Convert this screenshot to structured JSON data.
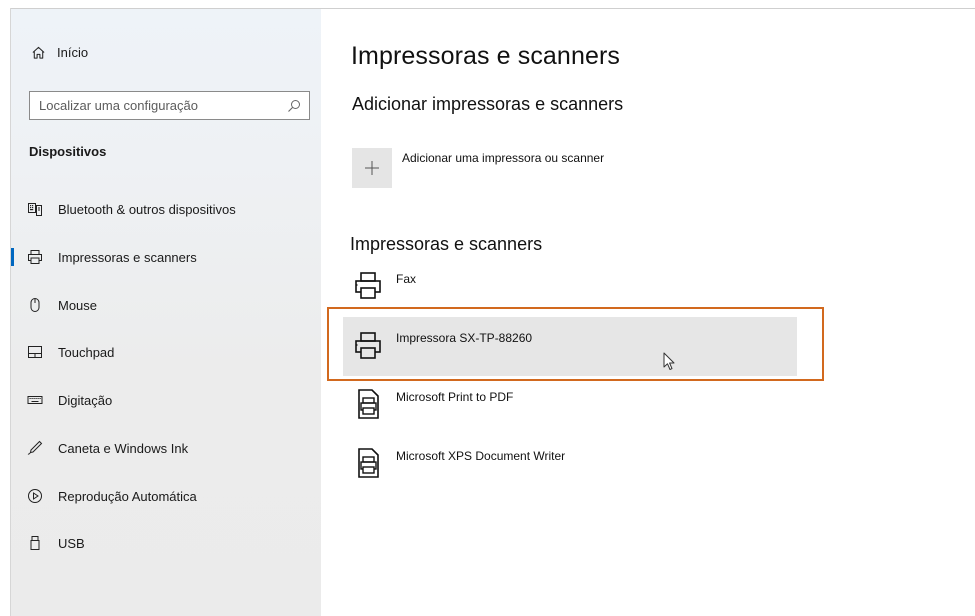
{
  "sidebar": {
    "home_label": "Início",
    "search_placeholder": "Localizar uma configuração",
    "section_title": "Dispositivos",
    "items": [
      {
        "label": "Bluetooth & outros dispositivos",
        "icon": "bluetooth-devices-icon"
      },
      {
        "label": "Impressoras e scanners",
        "icon": "printer-icon",
        "selected": true
      },
      {
        "label": "Mouse",
        "icon": "mouse-icon"
      },
      {
        "label": "Touchpad",
        "icon": "touchpad-icon"
      },
      {
        "label": "Digitação",
        "icon": "keyboard-icon"
      },
      {
        "label": "Caneta e Windows Ink",
        "icon": "pen-icon"
      },
      {
        "label": "Reprodução Automática",
        "icon": "autoplay-icon"
      },
      {
        "label": "USB",
        "icon": "usb-icon"
      }
    ]
  },
  "main": {
    "title": "Impressoras e scanners",
    "add_section_title": "Adicionar impressoras e scanners",
    "add_button_label": "Adicionar uma impressora ou scanner",
    "list_title": "Impressoras e scanners",
    "printers": [
      {
        "name": "Fax",
        "icon": "fax-printer-icon"
      },
      {
        "name": "Impressora SX-TP-88260",
        "icon": "printer-icon",
        "hovered": true
      },
      {
        "name": "Microsoft Print to PDF",
        "icon": "document-printer-icon"
      },
      {
        "name": "Microsoft XPS Document Writer",
        "icon": "document-printer-icon"
      }
    ]
  },
  "colors": {
    "accent": "#0067c0",
    "highlight_border": "#d2691e",
    "hover_background": "#e6e6e6"
  }
}
